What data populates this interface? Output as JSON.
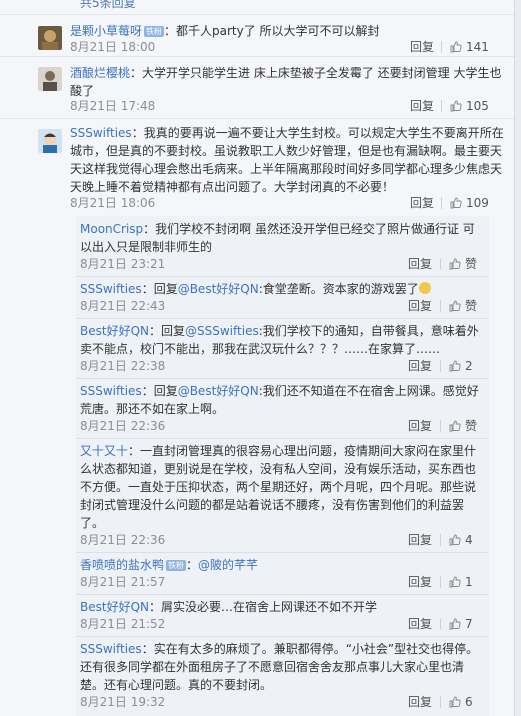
{
  "top_text": "共5条回复",
  "comments": [
    {
      "user": "是颗小草莓呀",
      "badge": "铁粉",
      "content": "：都千人party了 所以大学可不可以解封",
      "time": "8月21日 18:00",
      "reply": "回复",
      "likes": "141"
    },
    {
      "user": "酒酿烂樱桃",
      "content": "：大学开学只能学生进 床上床垫被子全发霉了 还要封闭管理  大学生也酸了",
      "time": "8月21日 17:48",
      "reply": "回复",
      "likes": "105"
    },
    {
      "user": "SSSwifties",
      "content": "：我真的要再说一遍不要让大学生封校。可以规定大学生不要离开所在城市，但是真的不要封校。虽说教职工人数少好管理，但是也有漏缺啊。最主要天天这样我觉得心理会憋出毛病来。上半年隔离那段时间好多同学都心理多少焦虑天天晚上睡不着觉精神都有点出问题了。大学封闭真的不必要！",
      "time": "8月21日 18:06",
      "reply": "回复",
      "likes": "109"
    }
  ],
  "replies": [
    {
      "user": "MoonCrisp",
      "content": "：我们学校不封闭啊 虽然还没开学但已经交了照片做通行证 可以出入只是限制非师生的",
      "time": "8月21日 23:21",
      "reply": "回复",
      "likes": "赞"
    },
    {
      "user": "SSSwifties",
      "prefix": "：回复",
      "mention": "@Best好好QN",
      "content": ":食堂垄断。资本家的游戏罢了",
      "time": "8月21日 22:43",
      "reply": "回复",
      "likes": "赞"
    },
    {
      "user": "Best好好QN",
      "prefix": "：回复",
      "mention": "@SSSwifties",
      "content": ":我们学校下的通知，自带餐具，意味着外卖不能点，校门不能出，那我在武汉玩什么？？？……在家算了……",
      "time": "8月21日 22:38",
      "reply": "回复",
      "likes": "2"
    },
    {
      "user": "SSSwifties",
      "prefix": "：回复",
      "mention": "@Best好好QN",
      "content": ":我们还不知道在不在宿舍上网课。感觉好荒唐。那还不如在家上啊。",
      "time": "8月21日 22:36",
      "reply": "回复",
      "likes": "赞"
    },
    {
      "user": "又十又十",
      "content": "：一直封闭管理真的很容易心理出问题，疫情期间大家闷在家里什么状态都知道，更别说是在学校，没有私人空间，没有娱乐活动，买东西也不方便。一直处于压抑状态，两个星期还好，两个月呢，四个月呢。那些说封闭式管理没什么问题的都是站着说话不腰疼，没有伤害到他们的利益罢了。",
      "time": "8月21日 22:36",
      "reply": "回复",
      "likes": "4"
    },
    {
      "user": "香喷喷的盐水鸭",
      "badge": "铁粉",
      "prefix": "：",
      "mention": "@陂的芊芊",
      "content": "",
      "time": "8月21日 21:57",
      "reply": "回复",
      "likes": "1"
    },
    {
      "user": "Best好好QN",
      "content": "：屑实没必要…在宿舍上网课还不如不开学",
      "time": "8月21日 21:52",
      "reply": "回复",
      "likes": "7"
    },
    {
      "user": "SSSwifties",
      "content": "：实在有太多的麻烦了。兼职都得停。“小社会”型社交也得停。还有很多同学都在外面租房子了不愿意回宿舍舍友那点事儿大家心里也清楚。还有心理问题。真的不要封闭。",
      "time": "8月21日 19:32",
      "reply": "回复",
      "likes": "6"
    }
  ]
}
